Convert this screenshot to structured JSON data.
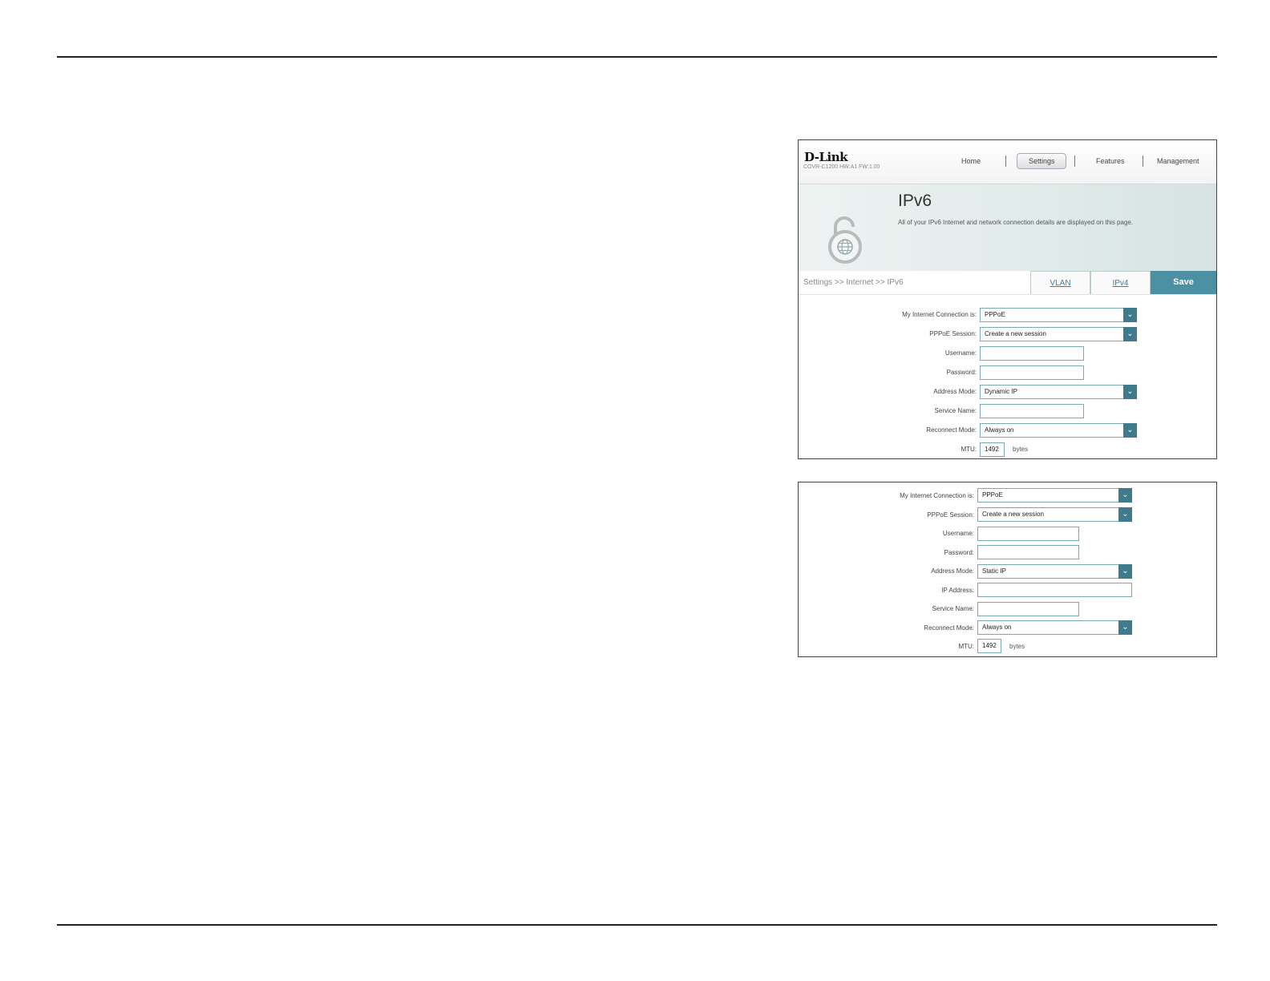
{
  "app": {
    "logo": "D-Link",
    "model": "COVR-C1200 HW:A1 FW:1.00"
  },
  "nav": [
    {
      "label": "Home"
    },
    {
      "label": "Settings"
    },
    {
      "label": "Features"
    },
    {
      "label": "Management"
    }
  ],
  "banner": {
    "title": "IPv6",
    "description": "All of your IPv6 Internet and network connection details are displayed on this page."
  },
  "breadcrumb": "Settings >> Internet >> IPv6",
  "tabs": {
    "vlan": "VLAN",
    "ipv4": "IPv4",
    "save": "Save"
  },
  "form1": {
    "connection_label": "My Internet Connection is:",
    "connection_value": "PPPoE",
    "session_label": "PPPoE Session:",
    "session_value": "Create a new session",
    "username_label": "Username:",
    "username_value": "",
    "password_label": "Password:",
    "password_value": "",
    "address_mode_label": "Address Mode:",
    "address_mode_value": "Dynamic IP",
    "service_name_label": "Service Name:",
    "service_name_value": "",
    "reconnect_label": "Reconnect Mode:",
    "reconnect_value": "Always on",
    "mtu_label": "MTU:",
    "mtu_value": "1492",
    "mtu_unit": "bytes"
  },
  "form2": {
    "connection_label": "My Internet Connection is:",
    "connection_value": "PPPoE",
    "session_label": "PPPoE Session:",
    "session_value": "Create a new session",
    "username_label": "Username:",
    "username_value": "",
    "password_label": "Password:",
    "password_value": "",
    "address_mode_label": "Address Mode:",
    "address_mode_value": "Static IP",
    "ip_address_label": "IP Address:",
    "ip_address_value": "",
    "service_name_label": "Service Name:",
    "service_name_value": "",
    "reconnect_label": "Reconnect Mode:",
    "reconnect_value": "Always on",
    "mtu_label": "MTU:",
    "mtu_value": "1492",
    "mtu_unit": "bytes"
  },
  "colors": {
    "accent": "#4b91a3",
    "dropdown_arrow": "#3f7b8c"
  }
}
